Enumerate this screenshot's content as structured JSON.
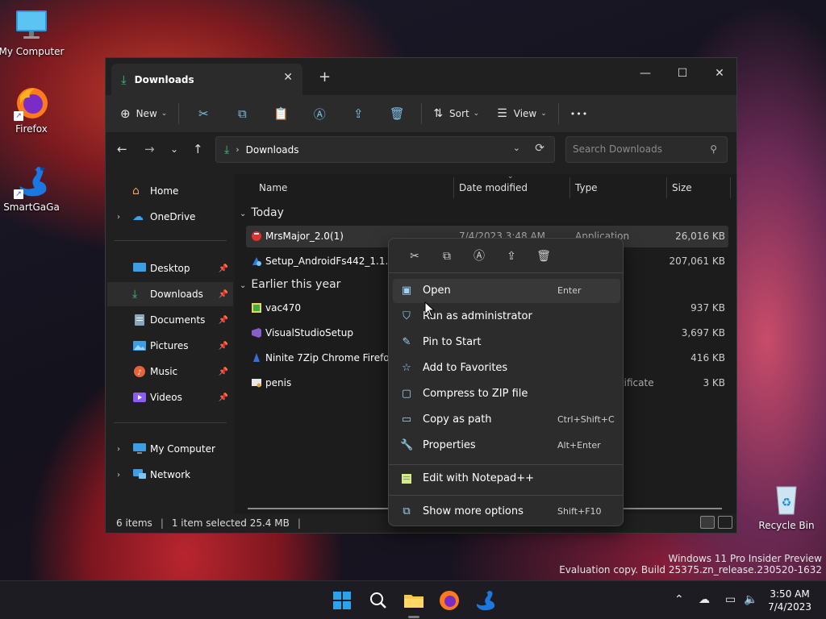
{
  "desktop": {
    "icons": [
      {
        "label": "My Computer"
      },
      {
        "label": "Firefox"
      },
      {
        "label": "SmartGaGa"
      }
    ],
    "recycle_bin": "Recycle Bin",
    "watermark_line1": "Windows 11 Pro Insider Preview",
    "watermark_line2": "Evaluation copy. Build 25375.zn_release.230520-1632"
  },
  "window": {
    "tab_title": "Downloads",
    "new_tab": "+",
    "controls": {
      "minimize": "—",
      "maximize": "☐",
      "close": "✕"
    }
  },
  "toolbar": {
    "new_label": "New",
    "sort_label": "Sort",
    "view_label": "View",
    "more": "•••"
  },
  "address": {
    "crumb": "Downloads",
    "search_placeholder": "Search Downloads"
  },
  "sidebar": {
    "items": [
      {
        "label": "Home"
      },
      {
        "label": "OneDrive"
      },
      {
        "label": "Desktop"
      },
      {
        "label": "Downloads"
      },
      {
        "label": "Documents"
      },
      {
        "label": "Pictures"
      },
      {
        "label": "Music"
      },
      {
        "label": "Videos"
      },
      {
        "label": "My Computer"
      },
      {
        "label": "Network"
      }
    ]
  },
  "columns": {
    "name": "Name",
    "date": "Date modified",
    "type": "Type",
    "size": "Size"
  },
  "groups": {
    "today": "Today",
    "earlier": "Earlier this year"
  },
  "files": [
    {
      "name": "MrsMajor_2.0(1)",
      "date": "7/4/2023 3:48 AM",
      "type": "Application",
      "size": "26,016 KB"
    },
    {
      "name": "Setup_AndroidFs442_1.1.646.",
      "date": "",
      "type": "",
      "size": "207,061 KB"
    },
    {
      "name": "vac470",
      "date": "",
      "type": "",
      "size": "937 KB"
    },
    {
      "name": "VisualStudioSetup",
      "date": "",
      "type": "",
      "size": "3,697 KB"
    },
    {
      "name": "Ninite 7Zip Chrome Firefox N",
      "date": "",
      "type": "",
      "size": "416 KB"
    },
    {
      "name": "penis",
      "date": "",
      "type": "rtificate",
      "size": "3 KB"
    }
  ],
  "status": {
    "items": "6 items",
    "selected": "1 item selected  25.4 MB"
  },
  "context_menu": {
    "items": [
      {
        "label": "Open",
        "key": "Enter"
      },
      {
        "label": "Run as administrator",
        "key": ""
      },
      {
        "label": "Pin to Start",
        "key": ""
      },
      {
        "label": "Add to Favorites",
        "key": ""
      },
      {
        "label": "Compress to ZIP file",
        "key": ""
      },
      {
        "label": "Copy as path",
        "key": "Ctrl+Shift+C"
      },
      {
        "label": "Properties",
        "key": "Alt+Enter"
      },
      {
        "label": "Edit with Notepad++",
        "key": ""
      },
      {
        "label": "Show more options",
        "key": "Shift+F10"
      }
    ]
  },
  "taskbar": {
    "time": "3:50 AM",
    "date": "7/4/2023"
  },
  "colors": {
    "accent": "#60cdff",
    "folder": "#f6c84a"
  }
}
